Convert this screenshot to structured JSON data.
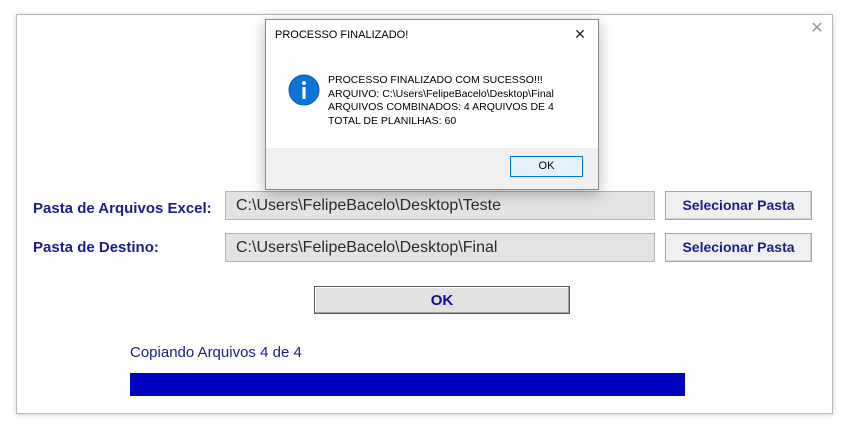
{
  "form": {
    "close_glyph": "✕",
    "label_source": "Pasta de Arquivos Excel:",
    "source_path": "C:\\Users\\FelipeBacelo\\Desktop\\Teste",
    "select_source_label": "Selecionar Pasta",
    "label_dest": "Pasta de Destino:",
    "dest_path": "C:\\Users\\FelipeBacelo\\Desktop\\Final",
    "select_dest_label": "Selecionar Pasta",
    "ok_label": "OK",
    "status_text": "Copiando Arquivos 4 de 4",
    "progress_percent": 100,
    "progress_color": "#0000c0"
  },
  "dialog": {
    "title": "PROCESSO FINALIZADO!",
    "close_glyph": "✕",
    "icon": "info-icon",
    "lines": [
      "PROCESSO FINALIZADO COM SUCESSO!!!",
      "ARQUIVO: C:\\Users\\FelipeBacelo\\Desktop\\Final",
      "ARQUIVOS COMBINADOS: 4 ARQUIVOS DE 4",
      "TOTAL DE PLANILHAS: 60"
    ],
    "ok_label": "OK",
    "accent_color": "#0078d7"
  }
}
